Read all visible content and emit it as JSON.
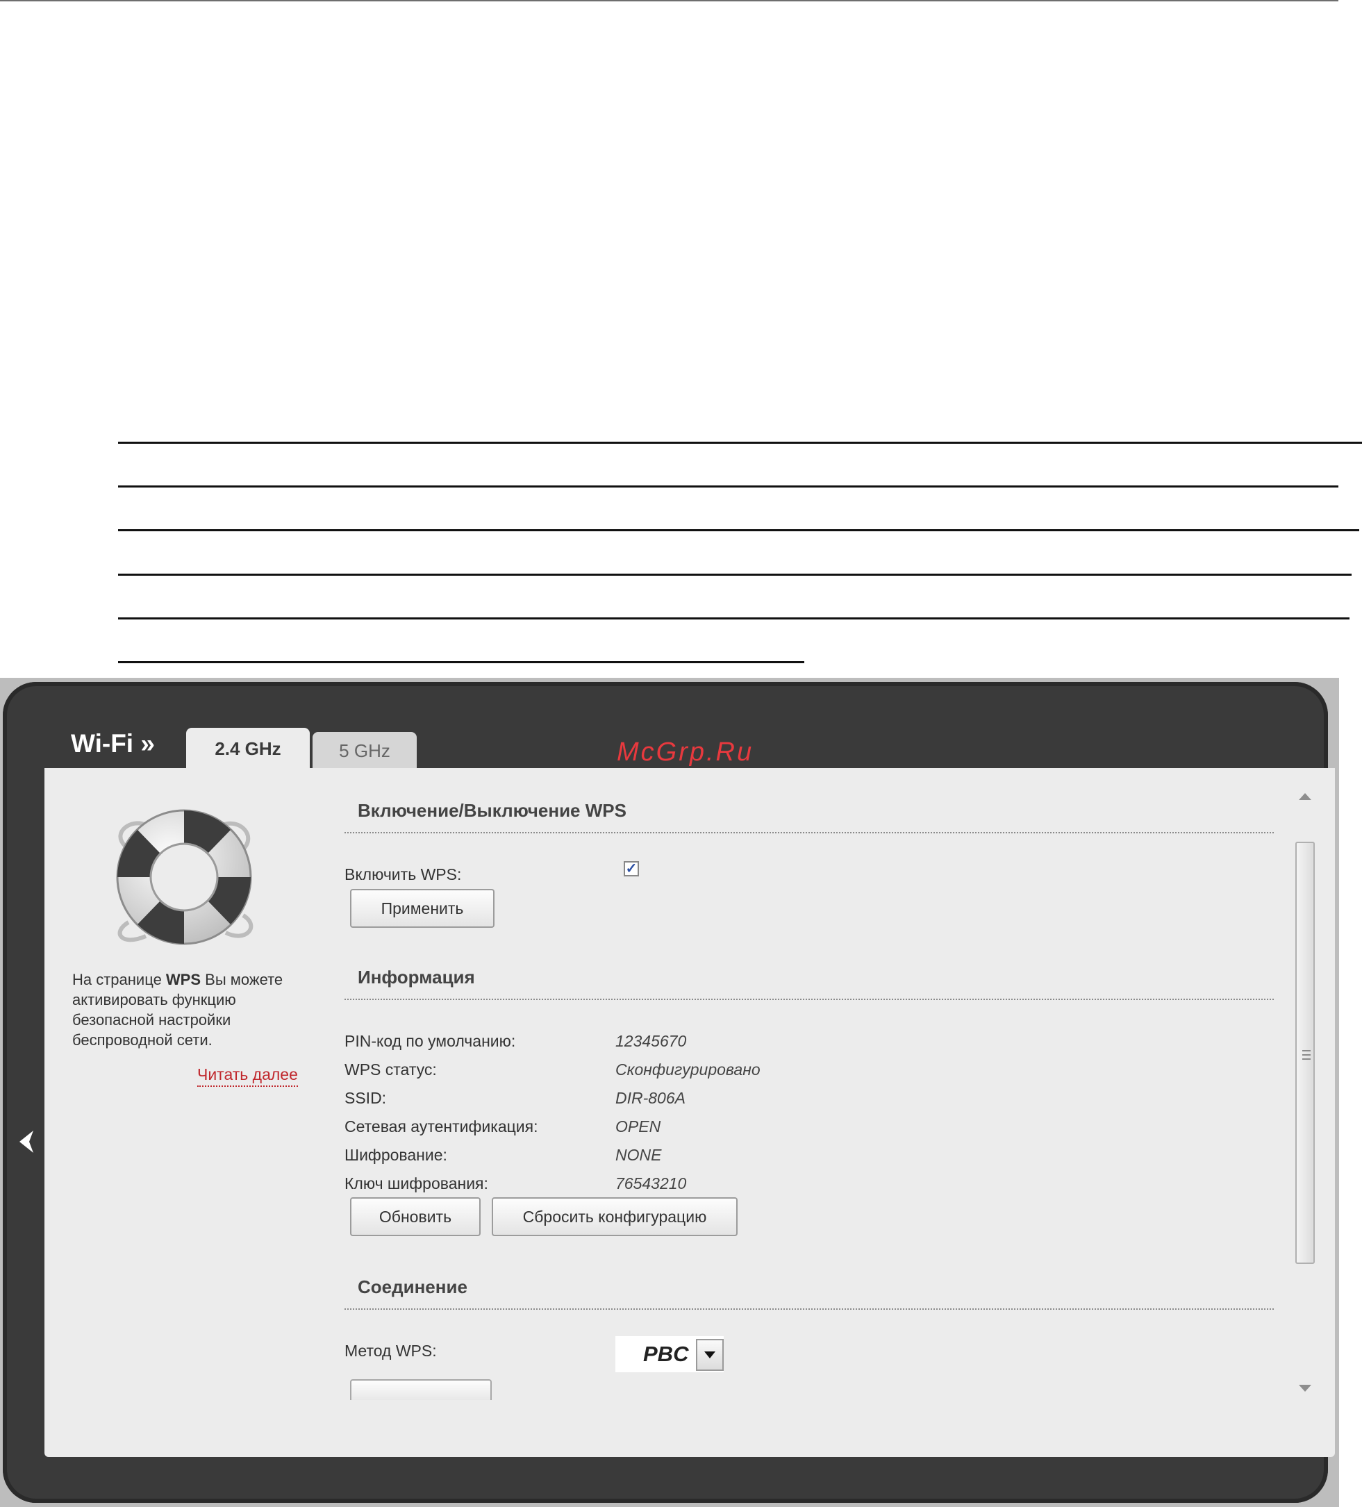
{
  "header": {
    "section_title": "Wi-Fi »",
    "tabs": [
      {
        "label": "2.4 GHz",
        "active": true
      },
      {
        "label": "5 GHz",
        "active": false
      }
    ],
    "watermark": "McGrp.Ru"
  },
  "sidebar": {
    "help_icon": "lifebuoy-icon",
    "help_text_prefix": "На странице ",
    "help_text_bold": "WPS",
    "help_text_suffix": " Вы можете активировать функцию безопасной настройки беспроводной сети.",
    "read_more_label": "Читать далее",
    "back_icon": "chevron-left-icon"
  },
  "wps_toggle": {
    "title": "Включение/Выключение WPS",
    "enable_label": "Включить WPS:",
    "enabled": true,
    "check_mark": "✓",
    "apply_label": "Применить"
  },
  "info": {
    "title": "Информация",
    "rows": [
      {
        "label": "PIN-код по умолчанию:",
        "value": "12345670"
      },
      {
        "label": "WPS статус:",
        "value": "Сконфигурировано"
      },
      {
        "label": "SSID:",
        "value": "DIR-806A"
      },
      {
        "label": "Сетевая аутентификация:",
        "value": "OPEN"
      },
      {
        "label": "Шифрование:",
        "value": "NONE"
      },
      {
        "label": "Ключ шифрования:",
        "value": "76543210"
      }
    ],
    "refresh_label": "Обновить",
    "reset_label": "Сбросить конфигурацию"
  },
  "connection": {
    "title": "Соединение",
    "method_label": "Метод WPS:",
    "method_value": "PBC"
  },
  "colors": {
    "frame": "#3a3a3a",
    "panel": "#ececec",
    "link": "#c0282d",
    "watermark": "#e8393e"
  }
}
